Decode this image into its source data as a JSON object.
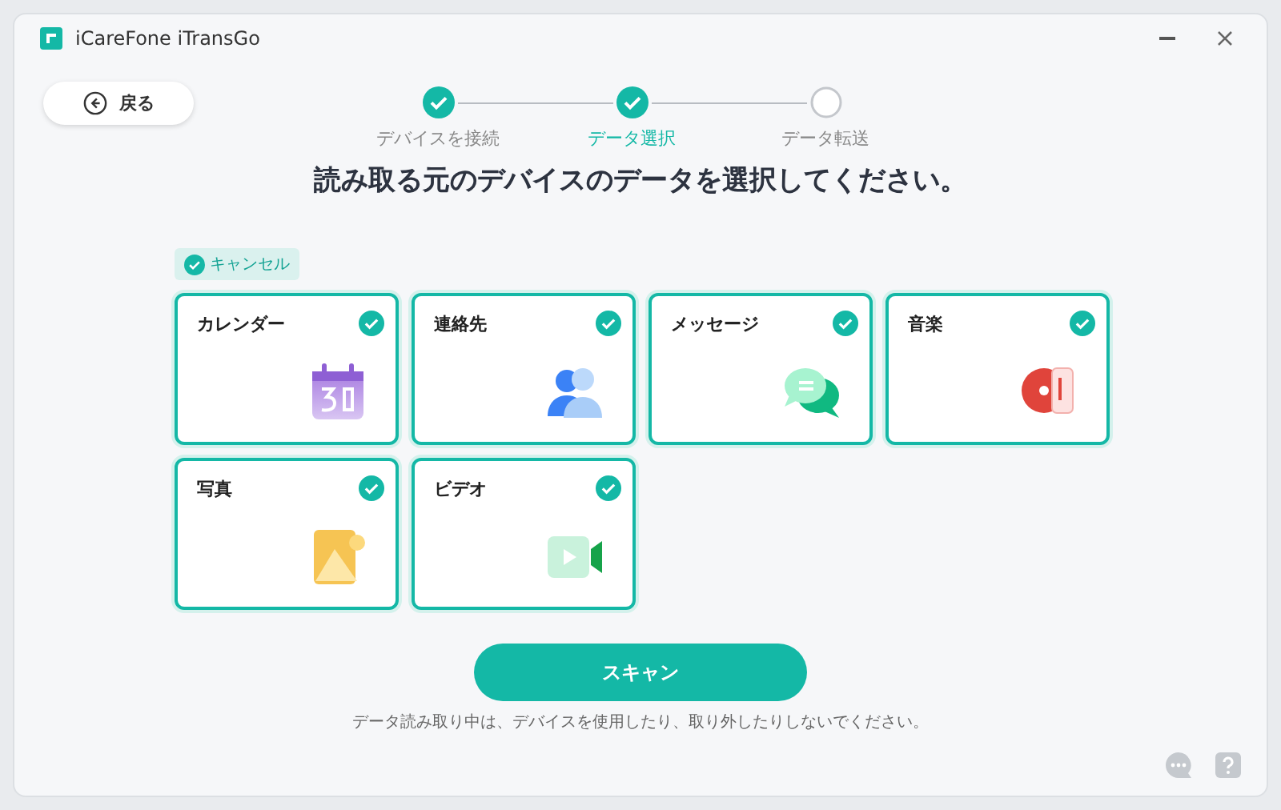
{
  "window": {
    "title": "iCareFone iTransGo"
  },
  "back_button": {
    "label": "戻る"
  },
  "steps": [
    {
      "label": "デバイスを接続",
      "checked": true,
      "selected": false
    },
    {
      "label": "データ選択",
      "checked": true,
      "selected": true
    },
    {
      "label": "データ転送",
      "checked": false,
      "selected": false
    }
  ],
  "heading": "読み取る元のデバイスのデータを選択してください。",
  "select_all": {
    "label": "キャンセル",
    "checked": true
  },
  "categories": [
    {
      "label": "カレンダー",
      "kind": "calendar",
      "checked": true
    },
    {
      "label": "連絡先",
      "kind": "contacts",
      "checked": true
    },
    {
      "label": "メッセージ",
      "kind": "messages",
      "checked": true
    },
    {
      "label": "音楽",
      "kind": "music",
      "checked": true
    },
    {
      "label": "写真",
      "kind": "photos",
      "checked": true
    },
    {
      "label": "ビデオ",
      "kind": "video",
      "checked": true
    }
  ],
  "scan_button": {
    "label": "スキャン"
  },
  "note": "データ読み取り中は、デバイスを使用したり、取り外したりしないでください。"
}
